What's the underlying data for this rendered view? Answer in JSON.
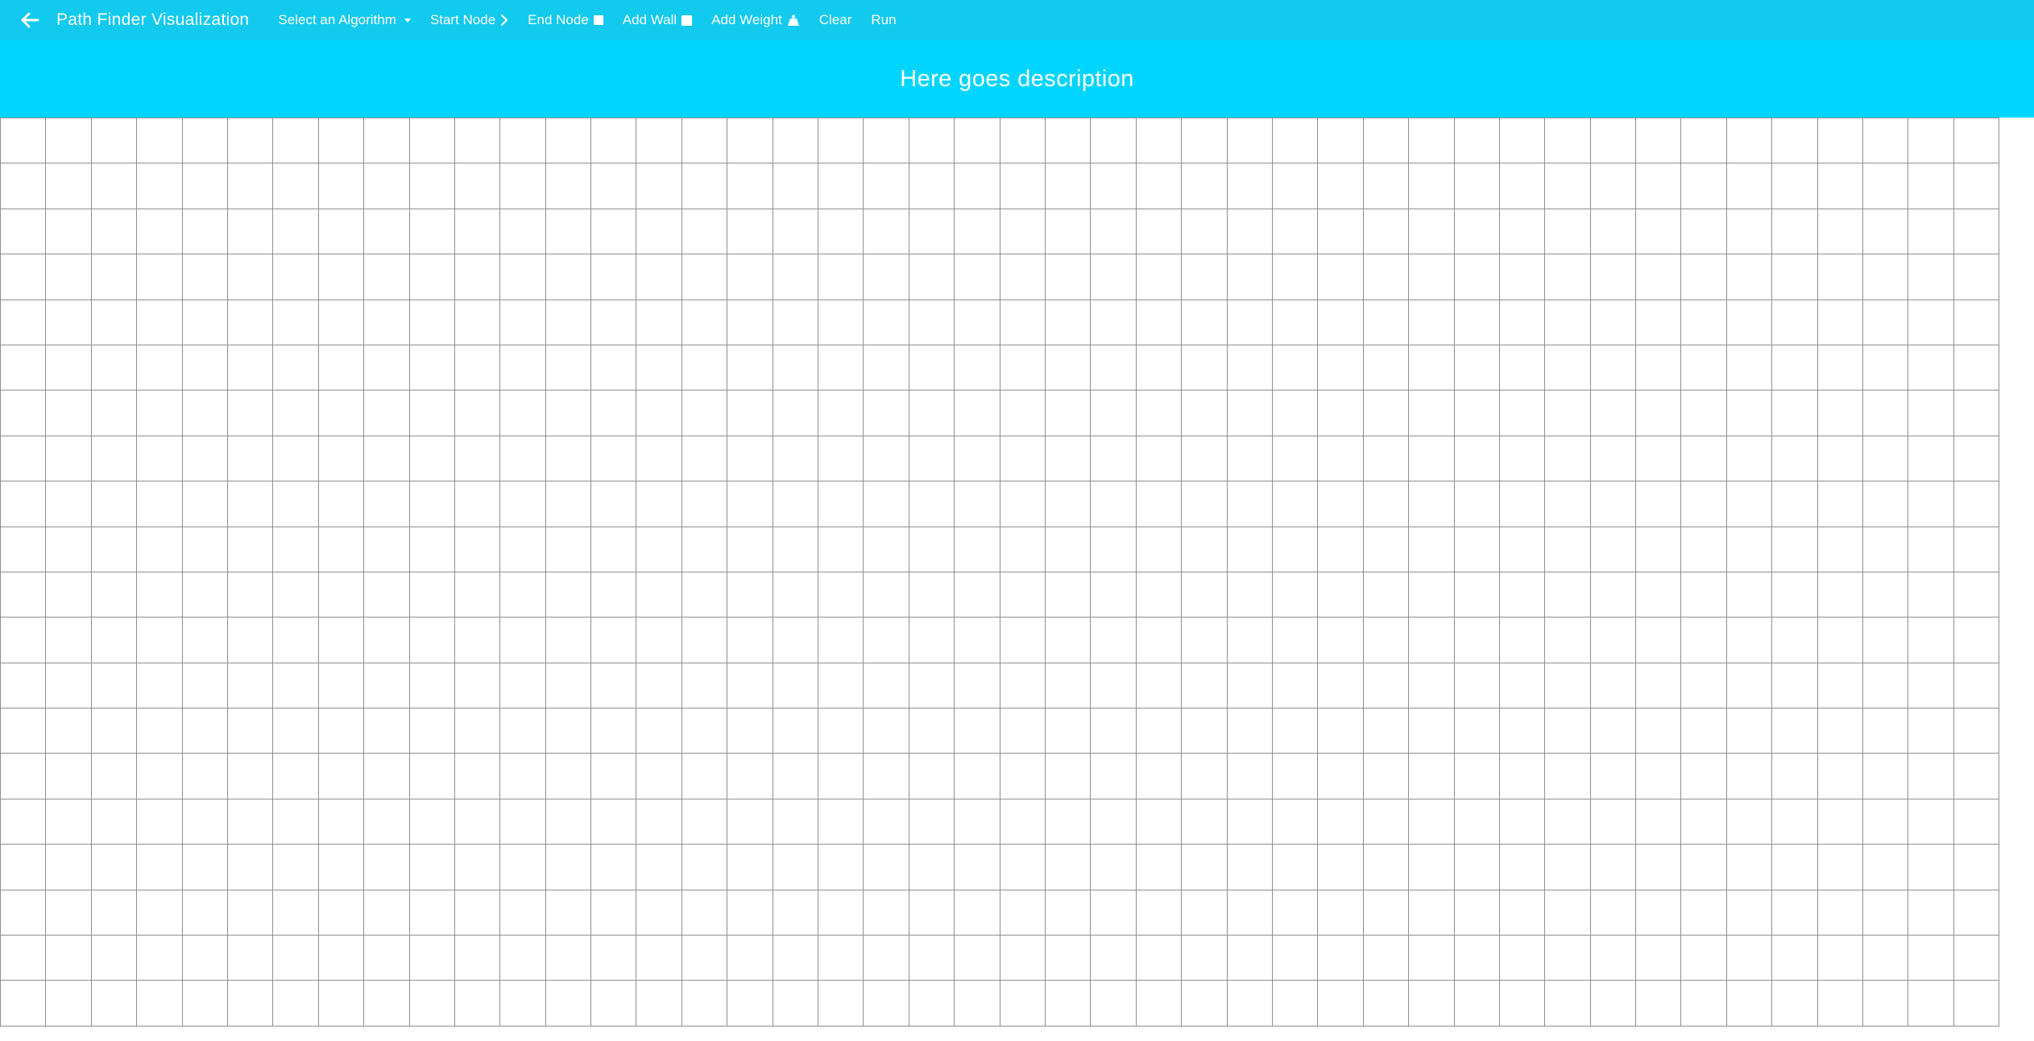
{
  "navbar": {
    "back_icon": "arrow-left-icon",
    "title": "Path Finder Visualization",
    "items": {
      "algorithm": {
        "label": "Select an Algorithm",
        "icon": "caret-down-icon"
      },
      "start_node": {
        "label": "Start Node",
        "icon": "chevron-right-icon"
      },
      "end_node": {
        "label": "End Node",
        "icon": "square-icon"
      },
      "add_wall": {
        "label": "Add Wall",
        "icon": "square-icon"
      },
      "add_weight": {
        "label": "Add Weight",
        "icon": "weight-icon"
      },
      "clear": {
        "label": "Clear"
      },
      "run": {
        "label": "Run"
      }
    }
  },
  "banner": {
    "description": "Here goes description"
  },
  "grid": {
    "columns": 44,
    "rows": 20,
    "cell_color": "#ffffff",
    "line_color": "#8f8f94"
  },
  "colors": {
    "navbar": "#11caee",
    "banner": "#00d5ff"
  }
}
